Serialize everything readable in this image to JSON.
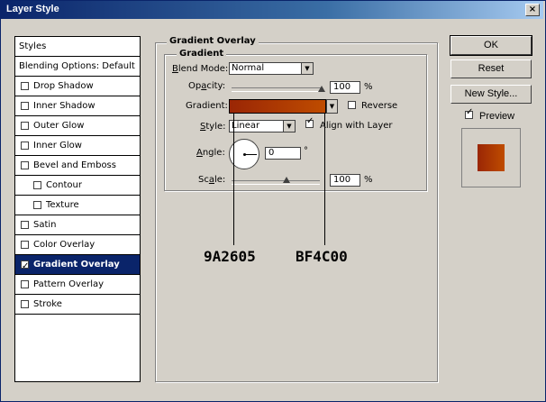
{
  "window": {
    "title": "Layer Style",
    "close_glyph": "×"
  },
  "sidebar": {
    "items": [
      {
        "label": "Styles",
        "checkbox": false,
        "checked": false,
        "selected": false,
        "indent": 0
      },
      {
        "label": "Blending Options: Default",
        "checkbox": false,
        "checked": false,
        "selected": false,
        "indent": 0
      },
      {
        "label": "Drop Shadow",
        "checkbox": true,
        "checked": false,
        "selected": false,
        "indent": 0
      },
      {
        "label": "Inner Shadow",
        "checkbox": true,
        "checked": false,
        "selected": false,
        "indent": 0
      },
      {
        "label": "Outer Glow",
        "checkbox": true,
        "checked": false,
        "selected": false,
        "indent": 0
      },
      {
        "label": "Inner Glow",
        "checkbox": true,
        "checked": false,
        "selected": false,
        "indent": 0
      },
      {
        "label": "Bevel and Emboss",
        "checkbox": true,
        "checked": false,
        "selected": false,
        "indent": 0
      },
      {
        "label": "Contour",
        "checkbox": true,
        "checked": false,
        "selected": false,
        "indent": 1
      },
      {
        "label": "Texture",
        "checkbox": true,
        "checked": false,
        "selected": false,
        "indent": 1
      },
      {
        "label": "Satin",
        "checkbox": true,
        "checked": false,
        "selected": false,
        "indent": 0
      },
      {
        "label": "Color Overlay",
        "checkbox": true,
        "checked": false,
        "selected": false,
        "indent": 0
      },
      {
        "label": "Gradient Overlay",
        "checkbox": true,
        "checked": true,
        "selected": true,
        "indent": 0
      },
      {
        "label": "Pattern Overlay",
        "checkbox": true,
        "checked": false,
        "selected": false,
        "indent": 0
      },
      {
        "label": "Stroke",
        "checkbox": true,
        "checked": false,
        "selected": false,
        "indent": 0
      }
    ]
  },
  "panel": {
    "group_title": "Gradient Overlay",
    "subgroup_title": "Gradient",
    "blend_mode": {
      "label": "Blend Mode:",
      "value": "Normal"
    },
    "opacity": {
      "label": "Opacity:",
      "value": "100",
      "unit": "%",
      "level": 100
    },
    "gradient": {
      "label": "Gradient:",
      "start_color": "#9A2605",
      "end_color": "#BF4C00"
    },
    "reverse": {
      "label": "Reverse",
      "checked": false
    },
    "style": {
      "label": "Style:",
      "value": "Linear"
    },
    "align_with_layer": {
      "label": "Align with Layer",
      "checked": true
    },
    "angle": {
      "label": "Angle:",
      "value": "0",
      "unit": "°"
    },
    "scale": {
      "label": "Scale:",
      "value": "100",
      "unit": "%",
      "level": 100
    }
  },
  "buttons": {
    "ok": "OK",
    "reset": "Reset",
    "new_style": "New Style..."
  },
  "preview": {
    "label": "Preview",
    "checked": true
  },
  "annotations": {
    "left_hex": "9A2605",
    "right_hex": "BF4C00"
  },
  "colors": {
    "title_bar": "#0a246a",
    "selection": "#0a246a",
    "dialog_bg": "#d4d0c8",
    "gradient_start": "#9A2605",
    "gradient_end": "#BF4C00"
  }
}
